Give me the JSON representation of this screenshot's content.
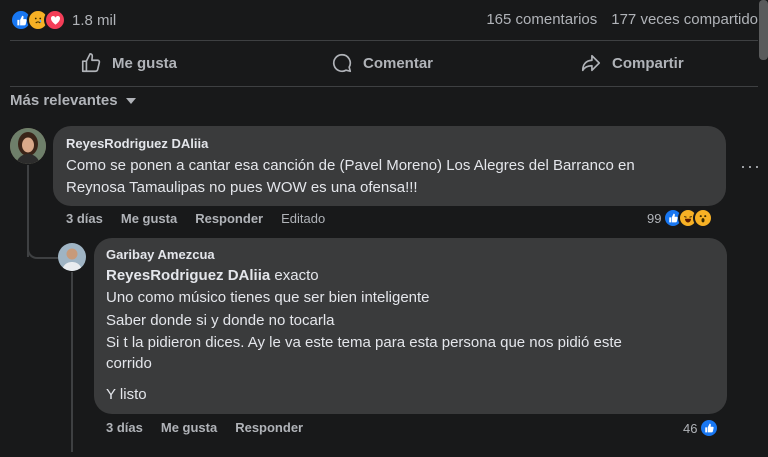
{
  "stats": {
    "reactions_count": "1.8 mil",
    "comments": "165 comentarios",
    "shares": "177 veces compartido"
  },
  "actions": {
    "like": "Me gusta",
    "comment": "Comentar",
    "share": "Compartir"
  },
  "sort": {
    "label": "Más relevantes"
  },
  "comments": [
    {
      "author": "ReyesRodriguez DAliia",
      "lines": [
        "Como se ponen a cantar esa canción de (Pavel Moreno) Los Alegres del Barranco en",
        "Reynosa Tamaulipas no pues WOW es una ofensa!!!"
      ],
      "time": "3 días",
      "like": "Me gusta",
      "reply": "Responder",
      "edited": "Editado",
      "reaction_count": "99"
    },
    {
      "author": "Garibay Amezcua",
      "mention": "ReyesRodriguez DAliia",
      "lines": [
        "exacto",
        "Uno como músico tienes que ser bien inteligente",
        "Saber donde si y donde no tocarla",
        "Si t la pidieron dices. Ay le va este tema para esta persona que nos pidió este",
        "corrido",
        "Y listo"
      ],
      "time": "3 días",
      "like": "Me gusta",
      "reply": "Responder",
      "reaction_count": "46"
    }
  ],
  "colors": {
    "background": "#18191a",
    "bubble": "#3a3b3c",
    "like_blue": "#1877f2",
    "love_red": "#f33e58",
    "haha_yellow": "#f7b125"
  }
}
